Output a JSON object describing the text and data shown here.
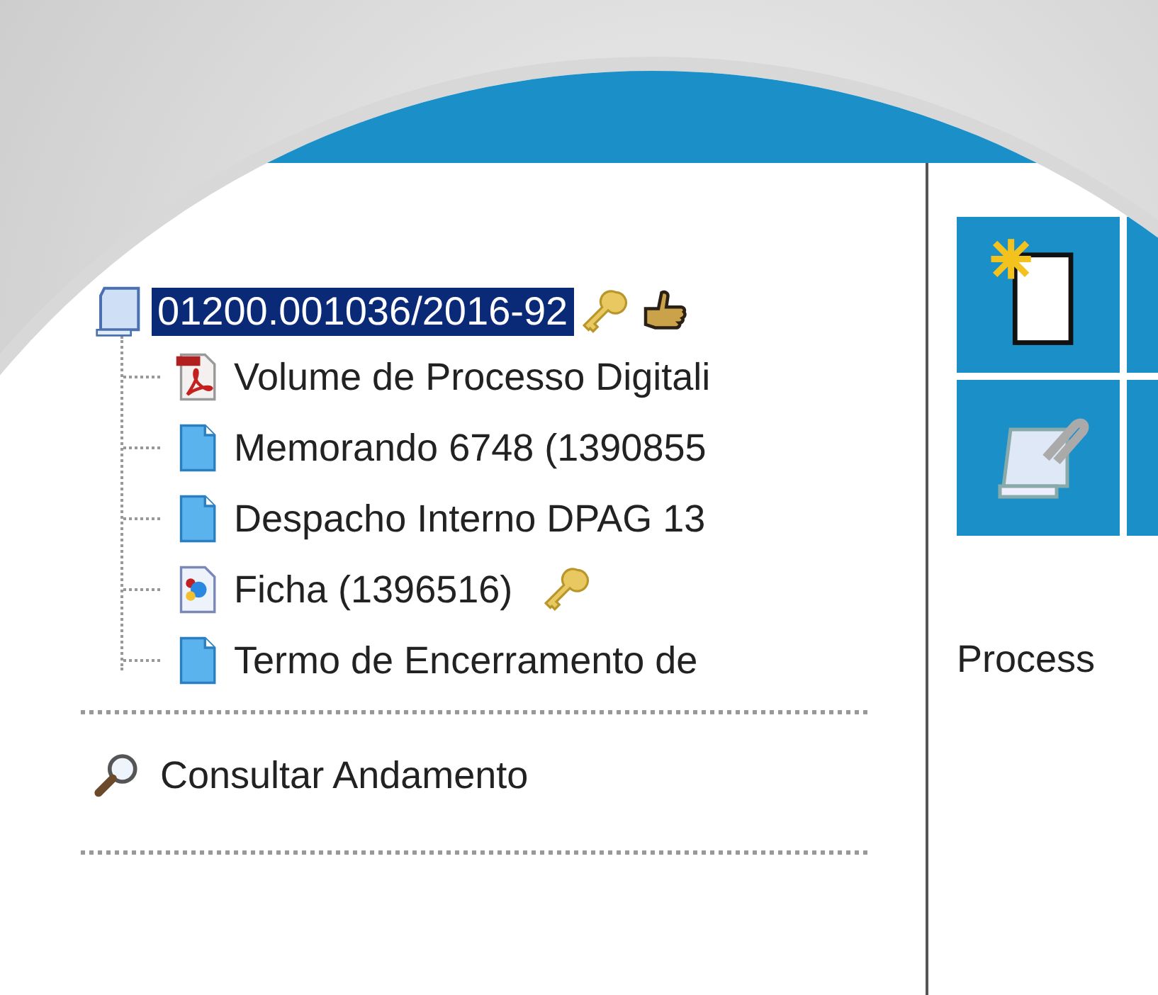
{
  "process": {
    "number": "01200.001036/2016-92",
    "selected": true,
    "restricted": true,
    "assigned": true
  },
  "documents": [
    {
      "kind": "pdf",
      "title": "Volume de Processo Digitali",
      "restricted": false
    },
    {
      "kind": "doc",
      "title": "Memorando 6748 (1390855",
      "restricted": false
    },
    {
      "kind": "doc",
      "title": "Despacho Interno DPAG 13",
      "restricted": false
    },
    {
      "kind": "form",
      "title": "Ficha (1396516)",
      "restricted": true
    },
    {
      "kind": "doc",
      "title": "Termo de Encerramento de",
      "restricted": false
    }
  ],
  "links": [
    {
      "label": "Consultar Andamento"
    }
  ],
  "right_panel": {
    "heading": "Process"
  }
}
